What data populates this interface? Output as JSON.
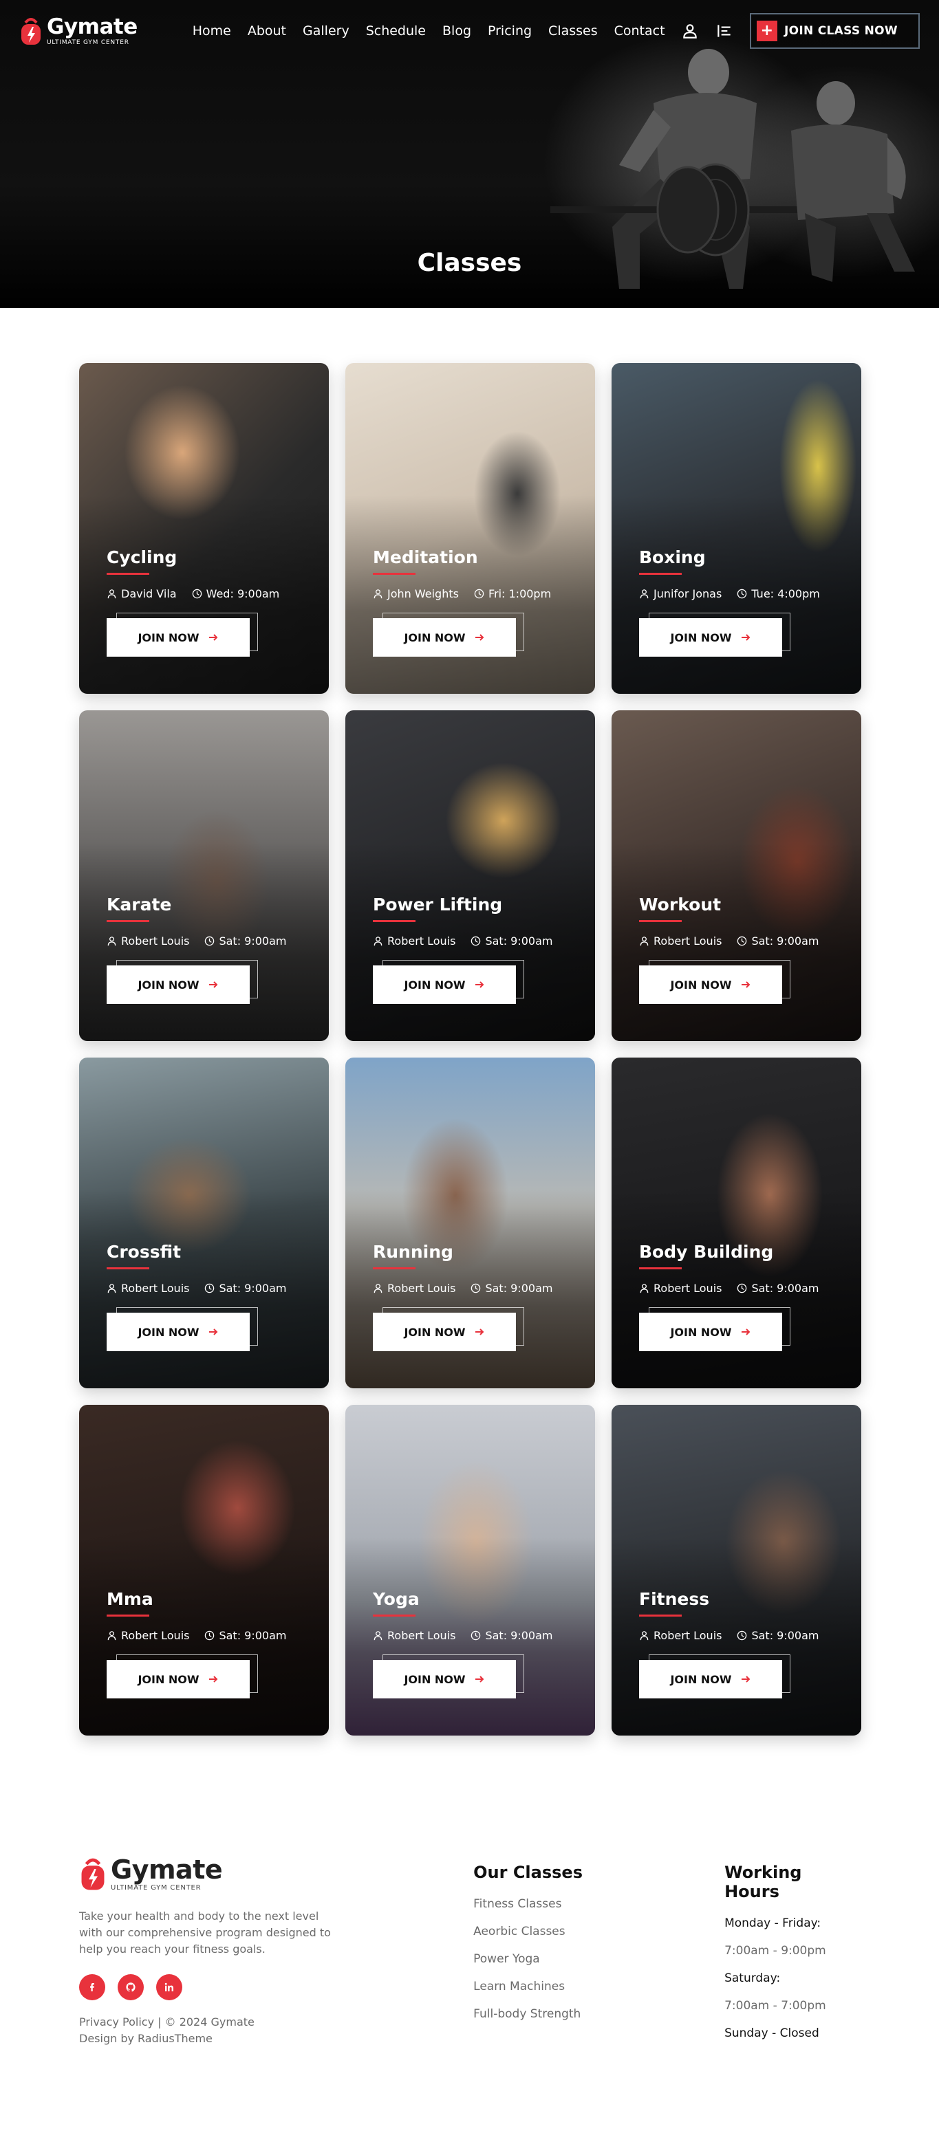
{
  "brand": {
    "name": "Gymate",
    "tagline": "ULTIMATE GYM CENTER",
    "accent": "#e8323c"
  },
  "nav": {
    "links": [
      "Home",
      "About",
      "Gallery",
      "Schedule",
      "Blog",
      "Pricing",
      "Classes",
      "Contact"
    ],
    "user_icon": "user-icon",
    "menu_icon": "menu-lines-icon",
    "join_label": "JOIN CLASS NOW"
  },
  "hero": {
    "title": "Classes"
  },
  "classes": [
    {
      "title": "Cycling",
      "trainer": "David Vila",
      "time": "Wed: 9:00am",
      "button": "JOIN NOW"
    },
    {
      "title": "Meditation",
      "trainer": "John Weights",
      "time": "Fri: 1:00pm",
      "button": "JOIN NOW"
    },
    {
      "title": "Boxing",
      "trainer": "Junifor Jonas",
      "time": "Tue: 4:00pm",
      "button": "JOIN NOW"
    },
    {
      "title": "Karate",
      "trainer": "Robert Louis",
      "time": "Sat: 9:00am",
      "button": "JOIN NOW"
    },
    {
      "title": "Power Lifting",
      "trainer": "Robert Louis",
      "time": "Sat: 9:00am",
      "button": "JOIN NOW"
    },
    {
      "title": "Workout",
      "trainer": "Robert Louis",
      "time": "Sat: 9:00am",
      "button": "JOIN NOW"
    },
    {
      "title": "Crossfit",
      "trainer": "Robert Louis",
      "time": "Sat: 9:00am",
      "button": "JOIN NOW"
    },
    {
      "title": "Running",
      "trainer": "Robert Louis",
      "time": "Sat: 9:00am",
      "button": "JOIN NOW"
    },
    {
      "title": "Body Building",
      "trainer": "Robert Louis",
      "time": "Sat: 9:00am",
      "button": "JOIN NOW"
    },
    {
      "title": "Mma",
      "trainer": "Robert Louis",
      "time": "Sat: 9:00am",
      "button": "JOIN NOW"
    },
    {
      "title": "Yoga",
      "trainer": "Robert Louis",
      "time": "Sat: 9:00am",
      "button": "JOIN NOW"
    },
    {
      "title": "Fitness",
      "trainer": "Robert Louis",
      "time": "Sat: 9:00am",
      "button": "JOIN NOW"
    }
  ],
  "footer": {
    "description": "Take your health and body to the next level with our comprehensive program designed to help you reach your fitness goals.",
    "socials": [
      "facebook-icon",
      "github-icon",
      "linkedin-icon"
    ],
    "legal_line1": "Privacy Policy | © 2024 Gymate",
    "legal_line2": "Design by RadiusTheme",
    "classes_heading": "Our Classes",
    "class_links": [
      "Fitness Classes",
      "Aeorbic Classes",
      "Power Yoga",
      "Learn Machines",
      "Full-body Strength"
    ],
    "hours_heading": "Working Hours",
    "hours": [
      "Monday - Friday:",
      "7:00am - 9:00pm",
      "Saturday:",
      "7:00am - 7:00pm",
      "Sunday - Closed"
    ]
  }
}
